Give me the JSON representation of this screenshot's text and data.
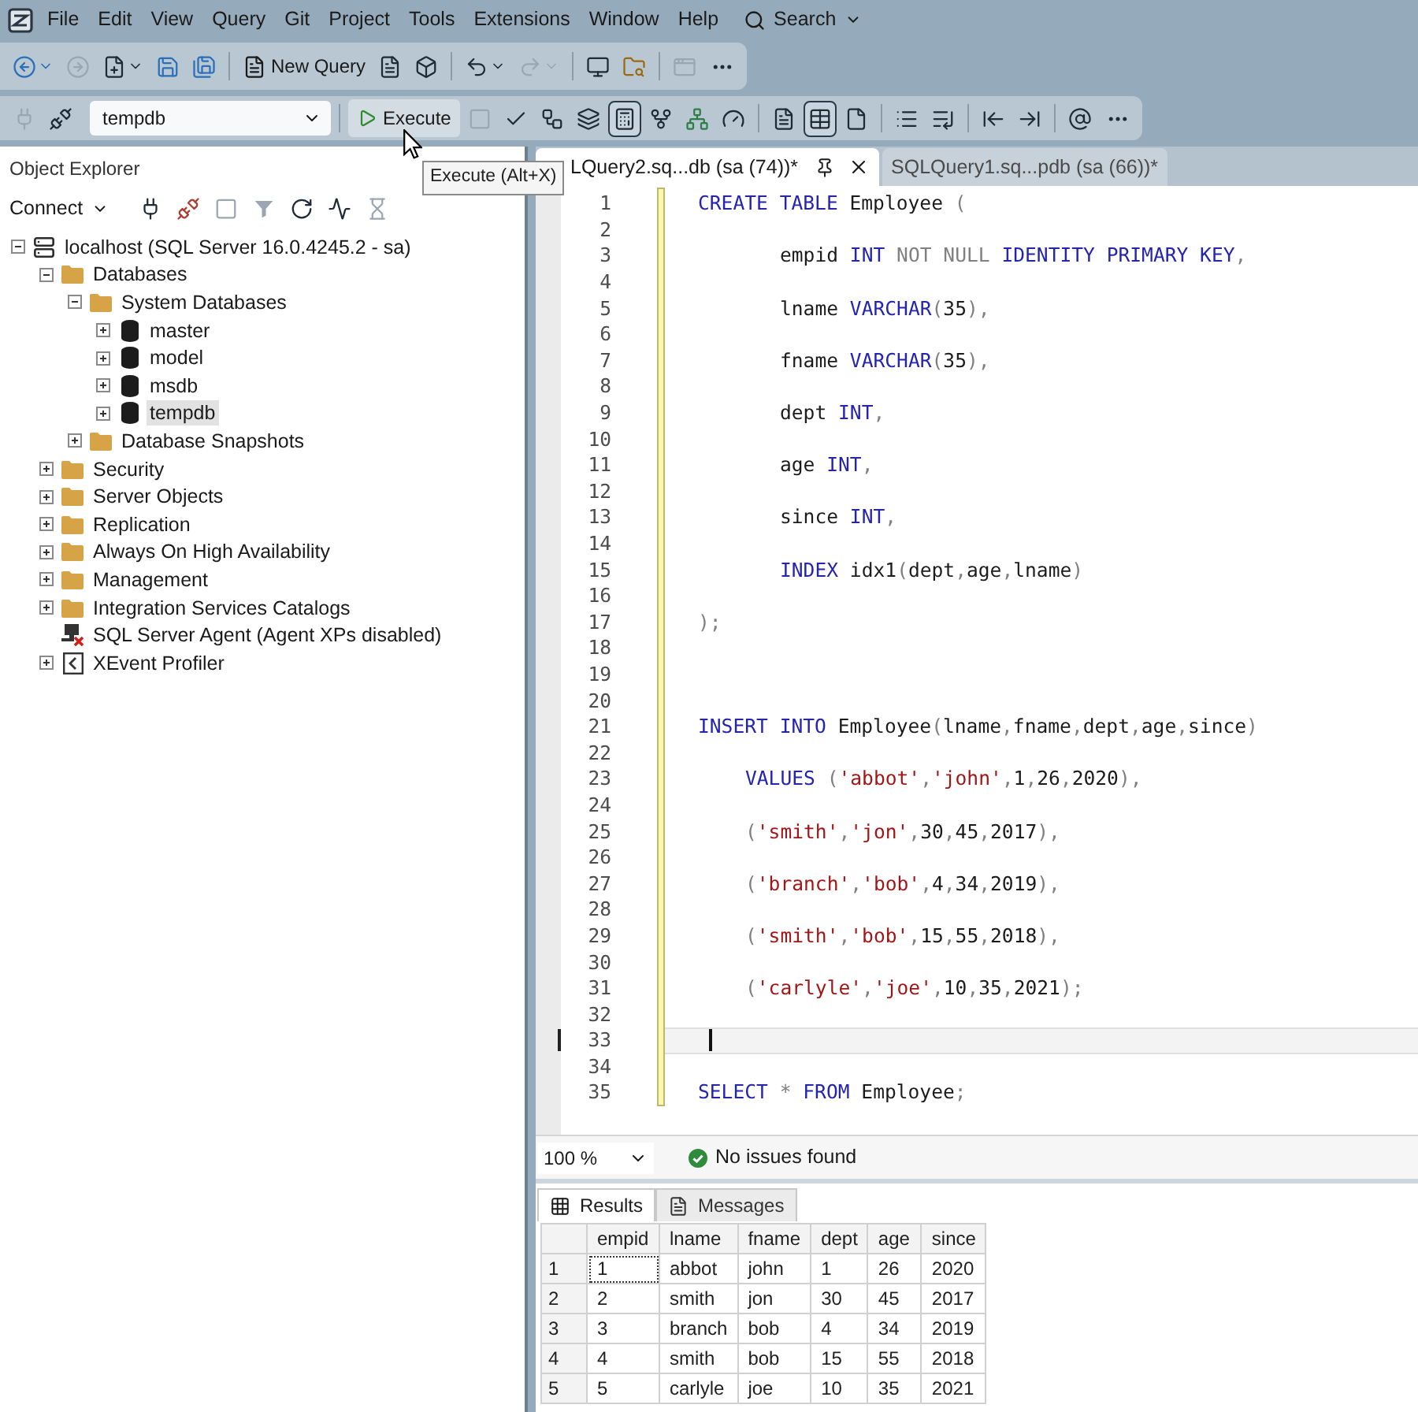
{
  "menu_bar": {
    "items": [
      "File",
      "Edit",
      "View",
      "Query",
      "Git",
      "Project",
      "Tools",
      "Extensions",
      "Window",
      "Help"
    ],
    "search": "Search"
  },
  "standard_toolbar": {
    "buttons": [
      {
        "disabled": false
      },
      {
        "disabled": true
      },
      {
        "disabled": false
      },
      {
        "disabled": false
      },
      {
        "disabled": false
      }
    ],
    "new_query": "New Query",
    "more_buttons": [
      {
        "disabled": false
      },
      {
        "disabled": false
      },
      {
        "disabled": false
      },
      {
        "disabled": true
      },
      {
        "disabled": false
      },
      {
        "disabled": false
      },
      {
        "disabled": true
      }
    ]
  },
  "sql_toolbar": {
    "buttons": [
      {
        "disabled": true
      },
      {
        "disabled": false
      }
    ],
    "database": "tempdb",
    "execute": {
      "label": "Execute",
      "hovered": true,
      "tooltip": "Execute (Alt+X)"
    },
    "more_buttons": [
      {
        "disabled": true,
        "selected": false
      },
      {
        "disabled": false,
        "selected": false
      },
      {
        "disabled": false,
        "selected": false
      },
      {
        "disabled": false,
        "selected": false
      },
      {
        "disabled": false,
        "selected": true
      },
      {
        "disabled": false,
        "selected": false
      },
      {
        "disabled": false,
        "selected": false
      },
      {
        "disabled": false,
        "selected": false
      },
      {
        "disabled": false,
        "selected": false
      },
      {
        "disabled": false,
        "selected": true
      },
      {
        "disabled": false,
        "selected": false
      },
      {
        "disabled": false,
        "selected": false
      },
      {
        "disabled": false,
        "selected": false
      },
      {
        "disabled": false,
        "selected": false
      },
      {
        "disabled": false,
        "selected": false
      },
      {
        "disabled": false,
        "selected": false
      }
    ]
  },
  "object_explorer": {
    "title": "Object Explorer",
    "connect": "Connect",
    "buttons": [
      {
        "disabled": false
      },
      {
        "disabled": false
      },
      {
        "disabled": true
      },
      {
        "disabled": true
      },
      {
        "disabled": false
      },
      {
        "disabled": false
      },
      {
        "disabled": true
      }
    ],
    "tree": [
      {
        "label": "localhost (SQL Server 16.0.4245.2 - sa)",
        "kind": "server",
        "expanded": true,
        "selected": false,
        "children": [
          {
            "label": "Databases",
            "kind": "folder",
            "expanded": true,
            "selected": false,
            "children": [
              {
                "label": "System Databases",
                "kind": "folder",
                "expanded": true,
                "selected": false,
                "children": [
                  {
                    "label": "master",
                    "kind": "database",
                    "expanded": false,
                    "selected": false
                  },
                  {
                    "label": "model",
                    "kind": "database",
                    "expanded": false,
                    "selected": false
                  },
                  {
                    "label": "msdb",
                    "kind": "database",
                    "expanded": false,
                    "selected": false
                  },
                  {
                    "label": "tempdb",
                    "kind": "database",
                    "expanded": false,
                    "selected": true
                  }
                ]
              },
              {
                "label": "Database Snapshots",
                "kind": "folder",
                "expanded": false,
                "selected": false
              }
            ]
          },
          {
            "label": "Security",
            "kind": "folder",
            "expanded": false,
            "selected": false
          },
          {
            "label": "Server Objects",
            "kind": "folder",
            "expanded": false,
            "selected": false
          },
          {
            "label": "Replication",
            "kind": "folder",
            "expanded": false,
            "selected": false
          },
          {
            "label": "Always On High Availability",
            "kind": "folder",
            "expanded": false,
            "selected": false
          },
          {
            "label": "Management",
            "kind": "folder",
            "expanded": false,
            "selected": false
          },
          {
            "label": "Integration Services Catalogs",
            "kind": "folder",
            "expanded": false,
            "selected": false
          },
          {
            "label": "SQL Server Agent (Agent XPs disabled)",
            "kind": "agent",
            "selected": false
          },
          {
            "label": "XEvent Profiler",
            "kind": "profiler",
            "expanded": false,
            "selected": false
          }
        ]
      }
    ]
  },
  "editor": {
    "tabs": [
      {
        "label": "LQuery2.sq...db (sa (74))*",
        "selected": true
      },
      {
        "label": "SQLQuery1.sq...pdb (sa (66))*",
        "selected": false
      }
    ],
    "lines": [
      {
        "number": "1",
        "current": false,
        "kind": "top",
        "tokens": [
          {
            "kind": "keyword",
            "text": "CREATE"
          },
          {
            "kind": "keyword",
            "text": " TABLE"
          },
          {
            "kind": "plain",
            "text": " Employee"
          },
          {
            "kind": "operator",
            "text": " ("
          }
        ]
      },
      {
        "number": "2",
        "current": false
      },
      {
        "number": "3",
        "current": false,
        "kind": "inner",
        "tokens": [
          {
            "kind": "plain",
            "text": "empid"
          },
          {
            "kind": "keyword",
            "text": " INT"
          },
          {
            "kind": "operator",
            "text": " NOT NULL"
          },
          {
            "kind": "keyword",
            "text": " IDENTITY PRIMARY KEY",
            "suffix": ","
          }
        ]
      },
      {
        "number": "4",
        "current": false
      },
      {
        "number": "5",
        "current": false,
        "kind": "inner",
        "tokens": [
          {
            "kind": "plain",
            "text": "lname"
          },
          {
            "kind": "keyword",
            "text": " VARCHAR"
          },
          {
            "kind": "operator",
            "text": "("
          },
          {
            "kind": "plain",
            "text": "35"
          },
          {
            "kind": "operator",
            "text": "),"
          }
        ]
      },
      {
        "number": "6",
        "current": false
      },
      {
        "number": "7",
        "current": false,
        "kind": "inner",
        "tokens": [
          {
            "kind": "plain",
            "text": "fname"
          },
          {
            "kind": "keyword",
            "text": " VARCHAR"
          },
          {
            "kind": "operator",
            "text": "("
          },
          {
            "kind": "plain",
            "text": "35"
          },
          {
            "kind": "operator",
            "text": "),"
          }
        ]
      },
      {
        "number": "8",
        "current": false
      },
      {
        "number": "9",
        "current": false,
        "kind": "inner",
        "tokens": [
          {
            "kind": "plain",
            "text": "dept"
          },
          {
            "kind": "keyword",
            "text": " INT",
            "suffix": ","
          }
        ]
      },
      {
        "number": "10",
        "current": false
      },
      {
        "number": "11",
        "current": false,
        "kind": "inner",
        "tokens": [
          {
            "kind": "plain",
            "text": "age"
          },
          {
            "kind": "keyword",
            "text": " INT",
            "suffix": ","
          }
        ]
      },
      {
        "number": "12",
        "current": false
      },
      {
        "number": "13",
        "current": false,
        "kind": "inner",
        "tokens": [
          {
            "kind": "plain",
            "text": "since"
          },
          {
            "kind": "keyword",
            "text": " INT",
            "suffix": ","
          }
        ]
      },
      {
        "number": "14",
        "current": false
      },
      {
        "number": "15",
        "current": false,
        "kind": "inner",
        "tokens": [
          {
            "kind": "keyword",
            "text": "INDEX"
          },
          {
            "kind": "plain",
            "text": " idx1"
          },
          {
            "kind": "operator",
            "text": "("
          },
          {
            "kind": "plain",
            "text": "dept",
            "suffix": ","
          },
          {
            "kind": "plain",
            "text": "age",
            "suffix": ","
          },
          {
            "kind": "plain",
            "text": "lname"
          },
          {
            "kind": "operator",
            "text": ")"
          }
        ]
      },
      {
        "number": "16",
        "current": false
      },
      {
        "number": "17",
        "current": false,
        "kind": "top",
        "tokens": [
          {
            "kind": "operator",
            "text": ");"
          }
        ]
      },
      {
        "number": "18",
        "current": false
      },
      {
        "number": "19",
        "current": false
      },
      {
        "number": "20",
        "current": false
      },
      {
        "number": "21",
        "current": false,
        "kind": "top",
        "tokens": [
          {
            "kind": "keyword",
            "text": "INSERT INTO"
          },
          {
            "kind": "plain",
            "text": " Employee"
          },
          {
            "kind": "operator",
            "text": "("
          },
          {
            "kind": "plain",
            "text": "lname",
            "suffix": ","
          },
          {
            "kind": "plain",
            "text": "fname",
            "suffix": ","
          },
          {
            "kind": "plain",
            "text": "dept",
            "suffix": ","
          },
          {
            "kind": "plain",
            "text": "age",
            "suffix": ","
          },
          {
            "kind": "plain",
            "text": "since"
          },
          {
            "kind": "operator",
            "text": ")"
          }
        ]
      },
      {
        "number": "22",
        "current": false
      },
      {
        "number": "23",
        "current": false,
        "kind": "values",
        "tokens": [
          {
            "kind": "keyword",
            "text": "VALUES"
          },
          {
            "kind": "operator",
            "text": " ("
          },
          {
            "kind": "string",
            "text": "'abbot'",
            "suffix": ","
          },
          {
            "kind": "string",
            "text": "'john'",
            "suffix": ","
          },
          {
            "kind": "plain",
            "text": "1",
            "suffix": ","
          },
          {
            "kind": "plain",
            "text": "26",
            "suffix": ","
          },
          {
            "kind": "plain",
            "text": "2020"
          },
          {
            "kind": "operator",
            "text": "),"
          }
        ]
      },
      {
        "number": "24",
        "current": false
      },
      {
        "number": "25",
        "current": false,
        "kind": "values",
        "tokens": [
          {
            "kind": "operator",
            "text": "("
          },
          {
            "kind": "string",
            "text": "'smith'",
            "suffix": ","
          },
          {
            "kind": "string",
            "text": "'jon'",
            "suffix": ","
          },
          {
            "kind": "plain",
            "text": "30",
            "suffix": ","
          },
          {
            "kind": "plain",
            "text": "45",
            "suffix": ","
          },
          {
            "kind": "plain",
            "text": "2017"
          },
          {
            "kind": "operator",
            "text": "),"
          }
        ]
      },
      {
        "number": "26",
        "current": false
      },
      {
        "number": "27",
        "current": false,
        "kind": "values",
        "tokens": [
          {
            "kind": "operator",
            "text": "("
          },
          {
            "kind": "string",
            "text": "'branch'",
            "suffix": ","
          },
          {
            "kind": "string",
            "text": "'bob'",
            "suffix": ","
          },
          {
            "kind": "plain",
            "text": "4",
            "suffix": ","
          },
          {
            "kind": "plain",
            "text": "34",
            "suffix": ","
          },
          {
            "kind": "plain",
            "text": "2019"
          },
          {
            "kind": "operator",
            "text": "),"
          }
        ]
      },
      {
        "number": "28",
        "current": false
      },
      {
        "number": "29",
        "current": false,
        "kind": "values",
        "tokens": [
          {
            "kind": "operator",
            "text": "("
          },
          {
            "kind": "string",
            "text": "'smith'",
            "suffix": ","
          },
          {
            "kind": "string",
            "text": "'bob'",
            "suffix": ","
          },
          {
            "kind": "plain",
            "text": "15",
            "suffix": ","
          },
          {
            "kind": "plain",
            "text": "55",
            "suffix": ","
          },
          {
            "kind": "plain",
            "text": "2018"
          },
          {
            "kind": "operator",
            "text": "),"
          }
        ]
      },
      {
        "number": "30",
        "current": false
      },
      {
        "number": "31",
        "current": false,
        "kind": "values",
        "tokens": [
          {
            "kind": "operator",
            "text": "("
          },
          {
            "kind": "string",
            "text": "'carlyle'",
            "suffix": ","
          },
          {
            "kind": "string",
            "text": "'joe'",
            "suffix": ","
          },
          {
            "kind": "plain",
            "text": "10",
            "suffix": ","
          },
          {
            "kind": "plain",
            "text": "35",
            "suffix": ","
          },
          {
            "kind": "plain",
            "text": "2021"
          },
          {
            "kind": "operator",
            "text": ");"
          }
        ]
      },
      {
        "number": "32",
        "current": false
      },
      {
        "number": "33",
        "current": true
      },
      {
        "number": "34",
        "current": false
      },
      {
        "number": "35",
        "current": false,
        "kind": "top",
        "tokens": [
          {
            "kind": "keyword",
            "text": "SELECT"
          },
          {
            "kind": "operator",
            "text": " *"
          },
          {
            "kind": "keyword",
            "text": " FROM"
          },
          {
            "kind": "plain",
            "text": " Employee",
            "suffix": ";"
          }
        ]
      }
    ],
    "zoom": "100 %",
    "status": "No issues found"
  },
  "results": {
    "tabs": [
      {
        "label": "Results",
        "selected": true
      },
      {
        "label": "Messages",
        "selected": false
      }
    ],
    "columns": [
      "empid",
      "lname",
      "fname",
      "dept",
      "age",
      "since"
    ],
    "rows": [
      {
        "number": "1",
        "selected": true,
        "cells": [
          "1",
          "abbot",
          "john",
          "1",
          "26",
          "2020"
        ]
      },
      {
        "number": "2",
        "selected": false,
        "cells": [
          "2",
          "smith",
          "jon",
          "30",
          "45",
          "2017"
        ]
      },
      {
        "number": "3",
        "selected": false,
        "cells": [
          "3",
          "branch",
          "bob",
          "4",
          "34",
          "2019"
        ]
      },
      {
        "number": "4",
        "selected": false,
        "cells": [
          "4",
          "smith",
          "bob",
          "15",
          "55",
          "2018"
        ]
      },
      {
        "number": "5",
        "selected": false,
        "cells": [
          "5",
          "carlyle",
          "joe",
          "10",
          "35",
          "2021"
        ]
      }
    ]
  }
}
